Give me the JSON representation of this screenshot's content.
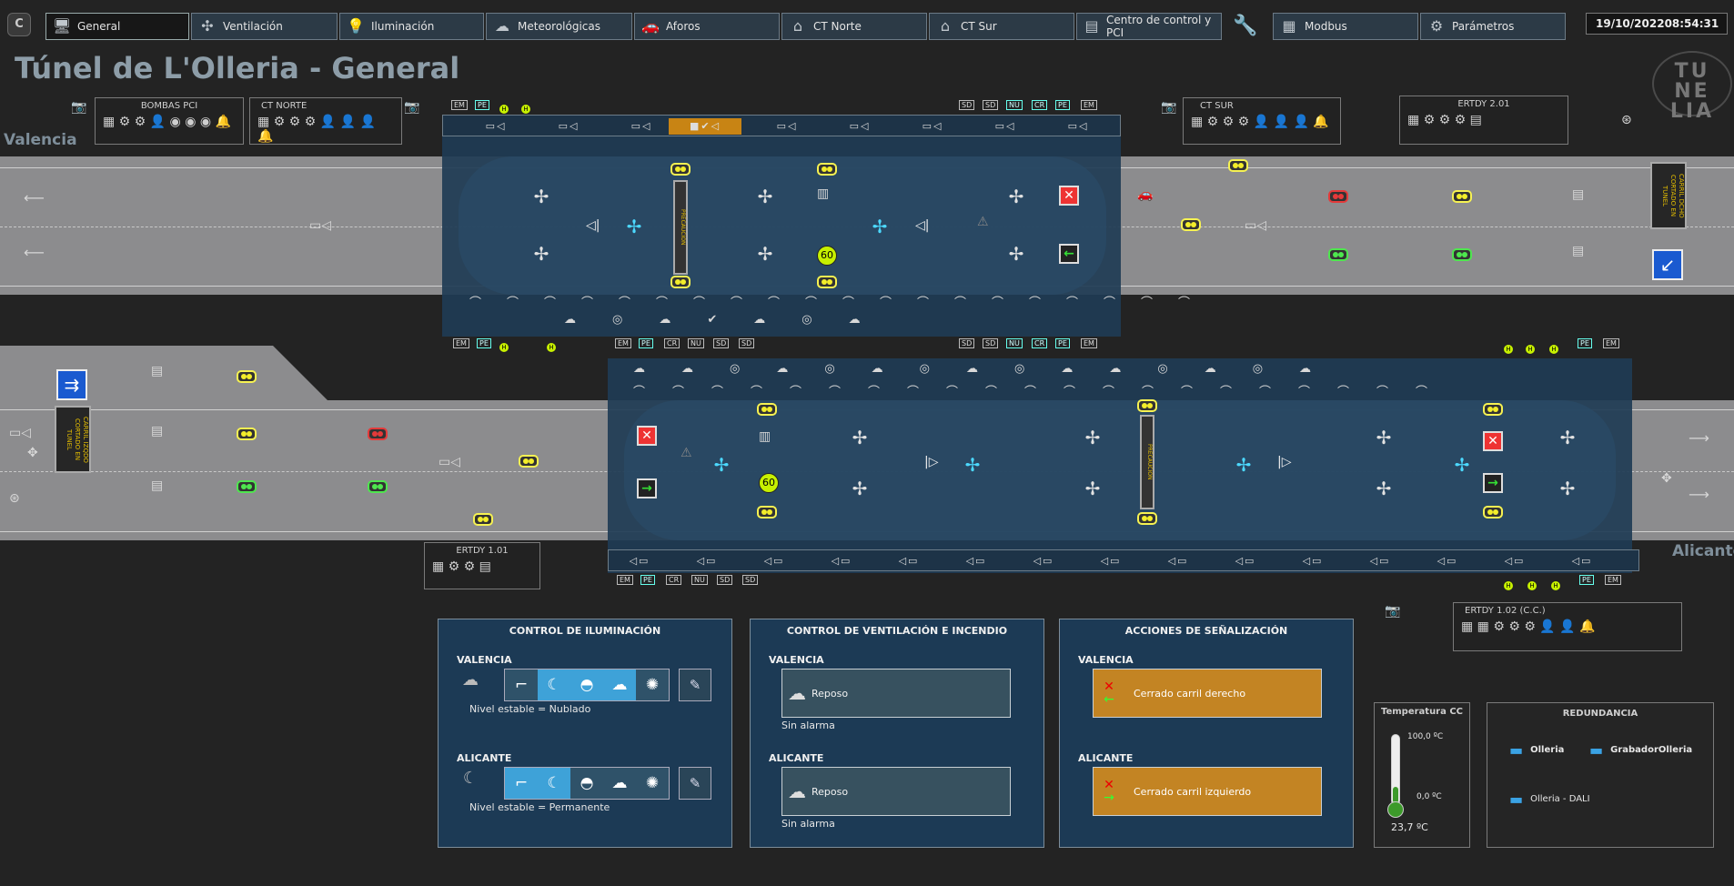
{
  "topbar": {
    "home_label": "C",
    "tabs": [
      {
        "label": "General",
        "icon": "computer-icon"
      },
      {
        "label": "Ventilación",
        "icon": "fan-icon"
      },
      {
        "label": "Iluminación",
        "icon": "bulb-icon"
      },
      {
        "label": "Meteorológicas",
        "icon": "cloud-icon"
      },
      {
        "label": "Aforos",
        "icon": "car-icon"
      },
      {
        "label": "CT Norte",
        "icon": "house-icon"
      },
      {
        "label": "CT Sur",
        "icon": "house-icon"
      },
      {
        "label": "Centro de control y PCI",
        "icon": "control-icon"
      },
      {
        "label": "Modbus",
        "icon": "server-icon"
      },
      {
        "label": "Parámetros",
        "icon": "gear-icon"
      }
    ],
    "date": "19/10/2022",
    "time": "08:54:31"
  },
  "title": "Túnel de L'Olleria - General",
  "cities": {
    "left": "Valencia",
    "right": "Alicante"
  },
  "logo": {
    "line1": "TU",
    "line2": "NE",
    "line3": "LIA"
  },
  "boxes": {
    "bombas": "BOMBAS PCI",
    "ct_norte": "CT NORTE",
    "ct_sur": "CT SUR",
    "ertdy_201": "ERTDY 2.01",
    "ertdy_101": "ERTDY 1.01",
    "ertdy_102": "ERTDY 1.02 (C.C.)"
  },
  "vms": {
    "upper_tunnel": "PRECAUCION",
    "lower_tunnel": "PRECAUCION",
    "right_sign": "CARRIL DCHO CORTADO EN TUNEL",
    "left_sign": "CARRIL IZQDO CORTADO EN TUNEL"
  },
  "speed_limit": "60",
  "tags": {
    "em": "EM",
    "pe": "PE",
    "nu": "NU",
    "cr": "CR",
    "sd": "SD"
  },
  "lighting": {
    "title": "CONTROL DE ILUMINACIÓN",
    "valencia_label": "VALENCIA",
    "valencia_status": "Nivel estable = Nublado",
    "alicante_label": "ALICANTE",
    "alicante_status": "Nivel estable = Permanente"
  },
  "ventilation": {
    "title": "CONTROL DE VENTILACIÓN E INCENDIO",
    "valencia_label": "VALENCIA",
    "valencia_state": "Reposo",
    "valencia_alarm": "Sin alarma",
    "alicante_label": "ALICANTE",
    "alicante_state": "Reposo",
    "alicante_alarm": "Sin alarma"
  },
  "signaling": {
    "title": "ACCIONES DE SEÑALIZACIÓN",
    "valencia_label": "VALENCIA",
    "valencia_action": "Cerrado carril derecho",
    "alicante_label": "ALICANTE",
    "alicante_action": "Cerrado carril izquierdo"
  },
  "temperature": {
    "title": "Temperatura CC",
    "max": "100,0 ºC",
    "min": "0,0 ºC",
    "value": "23,7 ºC",
    "level": 0.237
  },
  "redundancy": {
    "title": "REDUNDANCIA",
    "servers": [
      "Olleria",
      "GrabadorOlleria",
      "Olleria - DALI"
    ]
  },
  "colors": {
    "accent": "#3ea2d8",
    "warning": "#c38423",
    "tunnel": "#1f3c55"
  }
}
